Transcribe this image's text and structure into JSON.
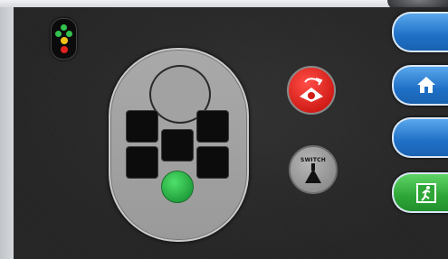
{
  "colors": {
    "screen_background": "#262626",
    "controller_body": "#a2a2a2",
    "action_green": "#2ea637",
    "nav_blue": "#1e70c7",
    "exit_green": "#2ea637",
    "alert_red": "#d21c17"
  },
  "status_indicator": {
    "icon": "traffic-light-icon"
  },
  "controller": {
    "dial": {
      "icon": "dial-circle"
    },
    "keys_count": 6,
    "go_button": {
      "icon": "green-circle-button"
    }
  },
  "mixer_button": {
    "icon": "mixer-red-icon"
  },
  "switch_button": {
    "label": "SWITCH",
    "icon": "switch-icon"
  },
  "side_nav": {
    "items": [
      {
        "id": "top",
        "icon": ""
      },
      {
        "id": "home",
        "icon": "home-icon"
      },
      {
        "id": "blank",
        "icon": ""
      },
      {
        "id": "exit",
        "icon": "exit-door-icon"
      }
    ]
  }
}
